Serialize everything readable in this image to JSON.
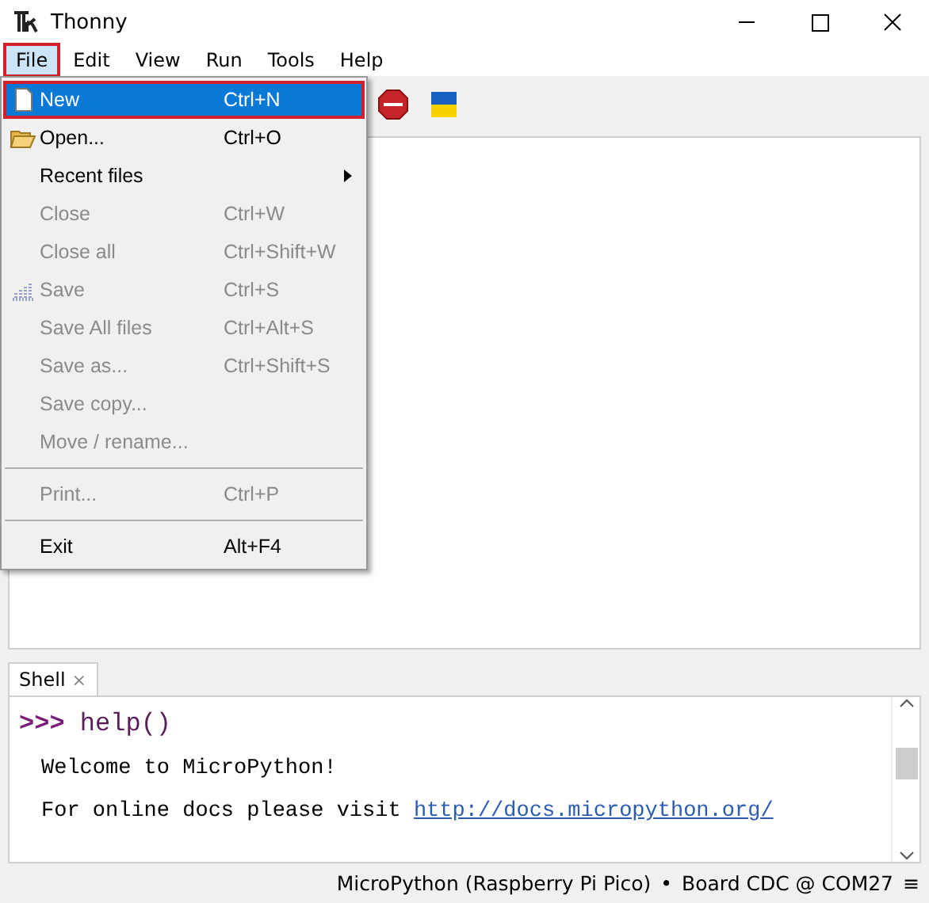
{
  "window": {
    "title": "Thonny"
  },
  "menubar": [
    {
      "label": "File",
      "selected": true
    },
    {
      "label": "Edit",
      "selected": false
    },
    {
      "label": "View",
      "selected": false
    },
    {
      "label": "Run",
      "selected": false
    },
    {
      "label": "Tools",
      "selected": false
    },
    {
      "label": "Help",
      "selected": false
    }
  ],
  "file_menu": {
    "items": [
      {
        "kind": "item",
        "label": "New",
        "shortcut": "Ctrl+N",
        "selected": true,
        "disabled": false
      },
      {
        "kind": "item",
        "label": "Open...",
        "shortcut": "Ctrl+O",
        "selected": false,
        "disabled": false
      },
      {
        "kind": "submenu",
        "label": "Recent files",
        "selected": false,
        "disabled": false
      },
      {
        "kind": "item",
        "label": "Close",
        "shortcut": "Ctrl+W",
        "selected": false,
        "disabled": true
      },
      {
        "kind": "item",
        "label": "Close all",
        "shortcut": "Ctrl+Shift+W",
        "selected": false,
        "disabled": true
      },
      {
        "kind": "item",
        "label": "Save",
        "shortcut": "Ctrl+S",
        "selected": false,
        "disabled": true
      },
      {
        "kind": "item",
        "label": "Save All files",
        "shortcut": "Ctrl+Alt+S",
        "selected": false,
        "disabled": true
      },
      {
        "kind": "item",
        "label": "Save as...",
        "shortcut": "Ctrl+Shift+S",
        "selected": false,
        "disabled": true
      },
      {
        "kind": "item",
        "label": "Save copy...",
        "selected": false,
        "disabled": true
      },
      {
        "kind": "item",
        "label": "Move / rename...",
        "selected": false,
        "disabled": true
      },
      {
        "kind": "separator"
      },
      {
        "kind": "item",
        "label": "Print...",
        "shortcut": "Ctrl+P",
        "selected": false,
        "disabled": true
      },
      {
        "kind": "separator"
      },
      {
        "kind": "item",
        "label": "Exit",
        "shortcut": "Alt+F4",
        "selected": false,
        "disabled": false
      }
    ]
  },
  "shell": {
    "tab": {
      "label": "Shell",
      "close": "×"
    },
    "lines": [
      {
        "kind": "input",
        "prompt": ">>>",
        "text": "help()"
      },
      {
        "kind": "output",
        "text": "Welcome to MicroPython!"
      },
      {
        "kind": "output",
        "text": "For online docs please visit ",
        "link": "http://docs.micropython.org/"
      }
    ]
  },
  "status_bar": {
    "interpreter": "MicroPython (Raspberry Pi Pico)",
    "separator": "•",
    "port": "Board CDC @ COM27",
    "menu": "≡"
  }
}
